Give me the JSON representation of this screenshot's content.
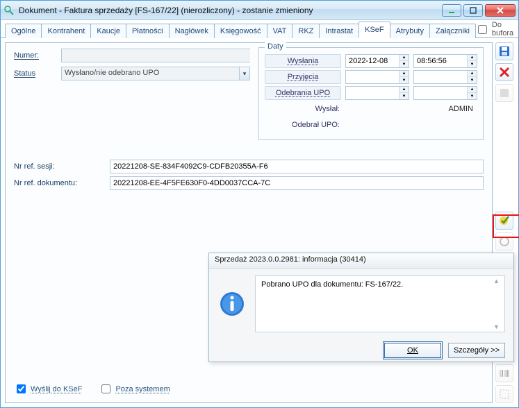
{
  "window": {
    "title": "Dokument - Faktura sprzedaży [FS-167/22] (nierozliczony) - zostanie zmieniony"
  },
  "tabs": [
    "Ogólne",
    "Kontrahent",
    "Kaucje",
    "Płatności",
    "Nagłówek",
    "Księgowość",
    "VAT",
    "RKZ",
    "Intrastat",
    "KSeF",
    "Atrybuty",
    "Załączniki"
  ],
  "active_tab_index": 9,
  "do_bufora_label": "Do bufora",
  "left": {
    "numer_label": "Numer:",
    "numer_value": "",
    "status_label": "Status",
    "status_value": "Wysłano/nie odebrano UPO"
  },
  "daty": {
    "legend": "Daty",
    "wyslania_label": "Wysłania",
    "wyslania_date": "2022-12-08",
    "wyslania_time": "08:56:56",
    "przyjecia_label": "Przyjęcia",
    "przyjecia_date": "",
    "przyjecia_time": "",
    "odebrania_label": "Odebrania UPO",
    "odebrania_date": "",
    "odebrania_time": "",
    "wyslal_label": "Wysłał:",
    "wyslal_value": "ADMIN",
    "odebral_label": "Odebrał UPO:",
    "odebral_value": ""
  },
  "refs": {
    "sesji_label": "Nr ref. sesji:",
    "sesji_value": "20221208-SE-834F4092C9-CDFB20355A-F6",
    "dokumentu_label": "Nr ref. dokumentu:",
    "dokumentu_value": "20221208-EE-4F5FE630F0-4DD0037CCA-7C"
  },
  "bottom": {
    "wyslij_label": "Wyślij do KSeF",
    "wyslij_checked": true,
    "poza_label": "Poza systemem",
    "poza_checked": false
  },
  "dialog": {
    "title": "Sprzedaż 2023.0.0.2981: informacja (30414)",
    "message": "Pobrano UPO dla dokumentu: FS-167/22.",
    "ok_label": "OK",
    "details_label": "Szczegóły >>"
  },
  "sidebar_icons": [
    "save",
    "delete",
    "check",
    "refresh",
    "upo",
    "barcode",
    "app"
  ]
}
